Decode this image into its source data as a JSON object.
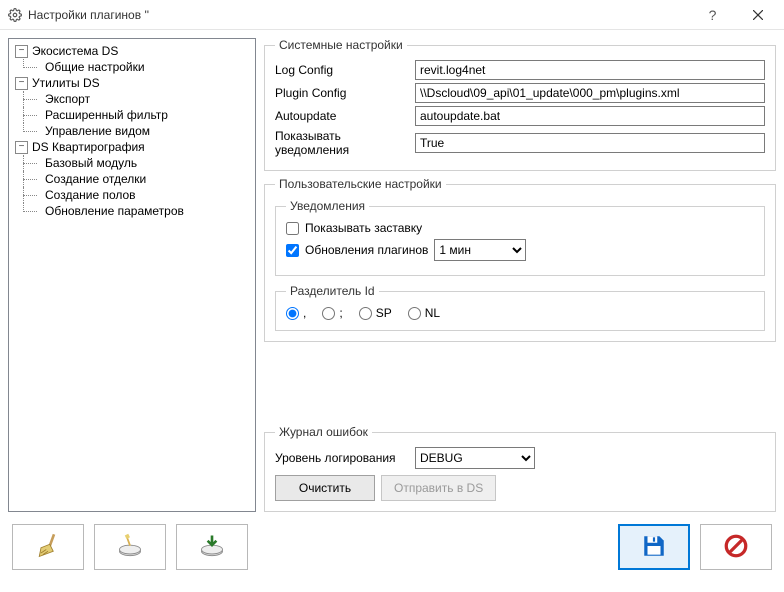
{
  "window": {
    "title": "Настройки плагинов ''"
  },
  "tree": {
    "nodes": [
      {
        "label": "Экосистема DS",
        "children": [
          "Общие настройки"
        ]
      },
      {
        "label": "Утилиты DS",
        "children": [
          "Экспорт",
          "Расширенный фильтр",
          "Управление видом"
        ]
      },
      {
        "label": "DS Квартирография",
        "children": [
          "Базовый модуль",
          "Создание отделки",
          "Создание полов",
          "Обновление параметров"
        ]
      }
    ]
  },
  "system_settings": {
    "legend": "Системные настройки",
    "log_config": {
      "label": "Log Config",
      "value": "revit.log4net"
    },
    "plugin_config": {
      "label": "Plugin Config",
      "value": "\\\\Dscloud\\09_api\\01_update\\000_pm\\plugins.xml"
    },
    "autoupdate": {
      "label": "Autoupdate",
      "value": "autoupdate.bat"
    },
    "show_notifications": {
      "label": "Показывать уведомления",
      "value": "True"
    }
  },
  "user_settings": {
    "legend": "Пользовательские настройки",
    "notifications": {
      "legend": "Уведомления",
      "show_splash": {
        "label": "Показывать заставку",
        "checked": false
      },
      "plugin_updates": {
        "label": "Обновления плагинов",
        "checked": true,
        "interval": "1 мин"
      }
    },
    "id_separator": {
      "legend": "Разделитель Id",
      "options": [
        ",",
        ";",
        "SP",
        "NL"
      ],
      "selected": ","
    }
  },
  "error_log": {
    "legend": "Журнал ошибок",
    "level_label": "Уровень логирования",
    "level_value": "DEBUG",
    "clear_btn": "Очистить",
    "send_btn": "Отправить в DS"
  },
  "bottom_icons": {
    "broom": "broom-icon",
    "tool": "tool-icon",
    "drive": "drive-icon",
    "save": "save-icon",
    "block": "block-icon"
  }
}
